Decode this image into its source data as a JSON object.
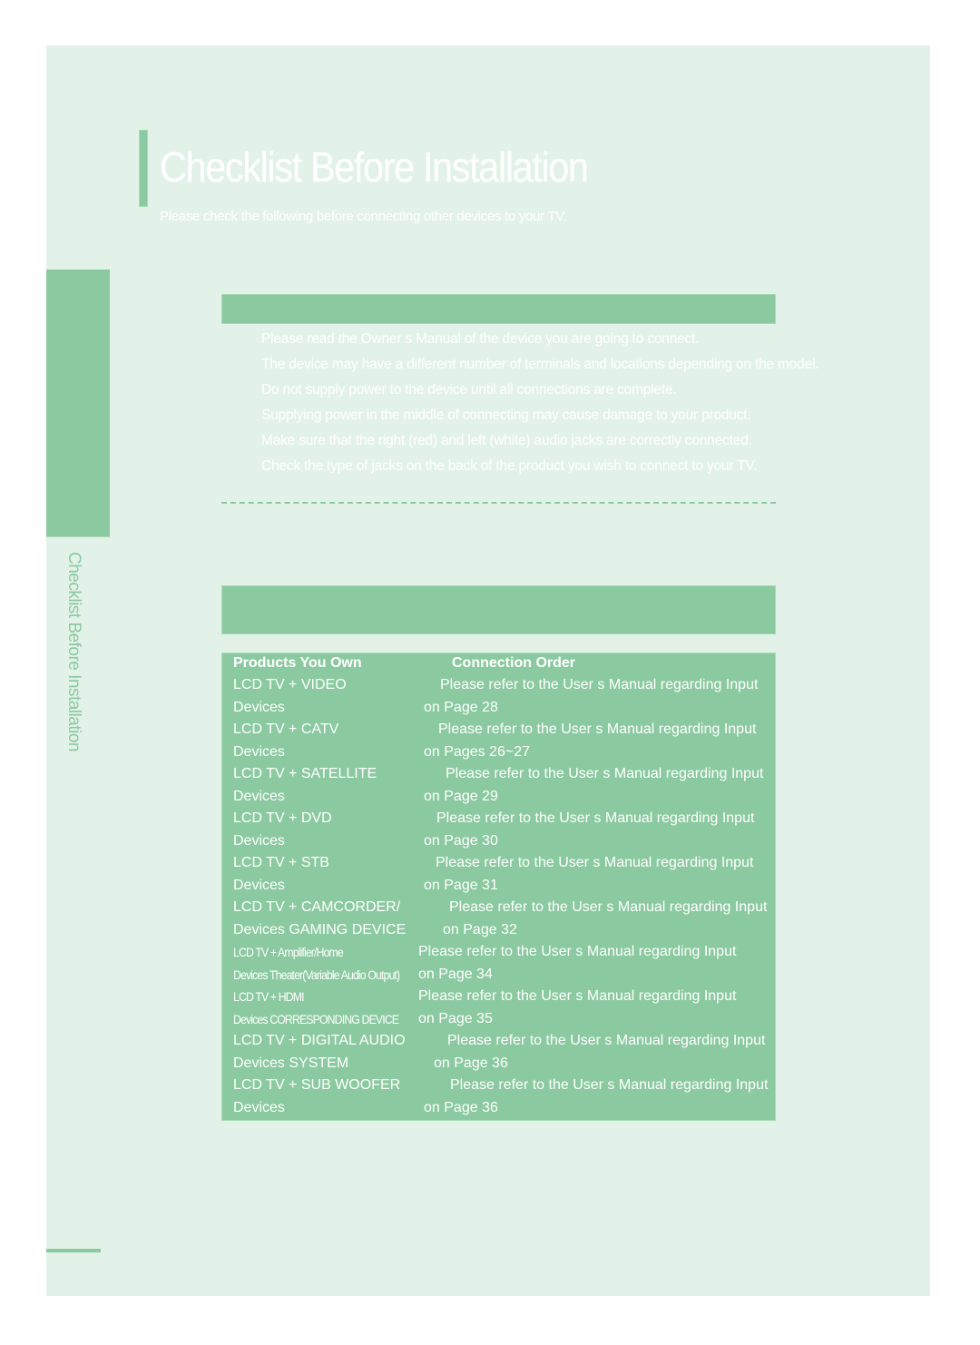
{
  "header": {
    "title": "Checklist Before Installation",
    "subtitle": "Please check the following before connecting other devices to your TV."
  },
  "sidebar": {
    "label": "Checklist Before Installation"
  },
  "notes": [
    "Please read the Owner s Manual of the device you are going to connect.",
    "The device may have a different number of terminals and locations depending on the model.",
    "Do not supply power to the device until all connections are complete.",
    "Supplying power in the middle of connecting may cause damage to your product.",
    "Make sure that the right (red) and left (white) audio jacks are correctly connected.",
    "Check the type of jacks on the back of the product you wish to connect to your TV."
  ],
  "table": {
    "headers": {
      "products": "Products You Own",
      "order": "Connection Order"
    },
    "rows": [
      {
        "product_l1": "LCD TV + VIDEO",
        "product_l2": "Devices",
        "order_l1": "Please refer to the User s Manual regarding Input",
        "order_l2": "on Page 28"
      },
      {
        "product_l1": "LCD TV + CATV",
        "product_l2": "Devices",
        "order_l1": "Please refer to the User s Manual regarding Input",
        "order_l2": "on Pages 26~27"
      },
      {
        "product_l1": "LCD TV + SATELLITE",
        "product_l2": "Devices",
        "order_l1": "Please refer to the User s Manual regarding Input",
        "order_l2": "on Page 29"
      },
      {
        "product_l1": "LCD TV + DVD",
        "product_l2": "Devices",
        "order_l1": "Please refer to the User s Manual regarding Input",
        "order_l2": "on Page 30"
      },
      {
        "product_l1": "LCD TV + STB",
        "product_l2": "Devices",
        "order_l1": "Please refer to the User s Manual regarding Input",
        "order_l2": "on Page 31"
      },
      {
        "product_l1": "LCD TV + CAMCORDER/",
        "product_l2": "Devices GAMING DEVICE",
        "order_l1": "Please refer to the User s Manual regarding Input",
        "order_l2": "on Page 32"
      },
      {
        "product_l1": "LCD TV + Amplifier/Home",
        "product_l2": "Devices Theater(Variable Audio Output)",
        "order_l1": "Please refer to the User s Manual regarding Input",
        "order_l2": "on Page 34"
      },
      {
        "product_l1": "LCD TV + HDMI",
        "product_l2": "Devices CORRESPONDING DEVICE",
        "order_l1": "Please refer to the User s Manual regarding Input",
        "order_l2": "on Page 35"
      },
      {
        "product_l1": "LCD TV + DIGITAL AUDIO",
        "product_l2": "Devices SYSTEM",
        "order_l1": "Please refer to the User s Manual regarding Input",
        "order_l2": "on Page 36"
      },
      {
        "product_l1": "LCD TV + SUB WOOFER",
        "product_l2": "Devices",
        "order_l1": "Please refer to the User s Manual regarding Input",
        "order_l2": "on Page 36"
      }
    ]
  },
  "colors": {
    "page_bg": "#e3f2e8",
    "accent": "#8bc9a0",
    "text": "#ffffff"
  }
}
